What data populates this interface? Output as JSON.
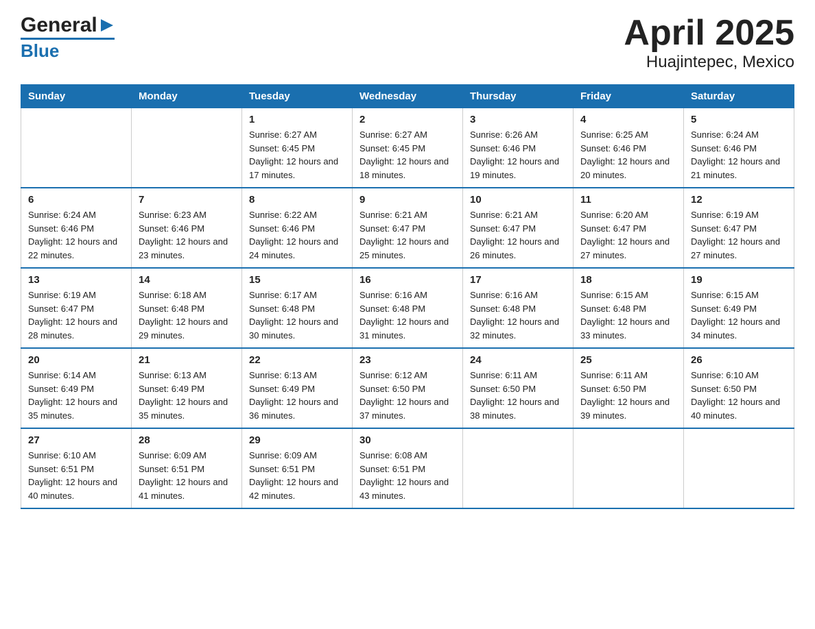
{
  "header": {
    "logo": {
      "general": "General",
      "arrow": "▶",
      "blue": "Blue"
    },
    "title": "April 2025",
    "subtitle": "Huajintepec, Mexico"
  },
  "days_of_week": [
    "Sunday",
    "Monday",
    "Tuesday",
    "Wednesday",
    "Thursday",
    "Friday",
    "Saturday"
  ],
  "weeks": [
    [
      {
        "day": "",
        "sunrise": "",
        "sunset": "",
        "daylight": ""
      },
      {
        "day": "",
        "sunrise": "",
        "sunset": "",
        "daylight": ""
      },
      {
        "day": "1",
        "sunrise": "Sunrise: 6:27 AM",
        "sunset": "Sunset: 6:45 PM",
        "daylight": "Daylight: 12 hours and 17 minutes."
      },
      {
        "day": "2",
        "sunrise": "Sunrise: 6:27 AM",
        "sunset": "Sunset: 6:45 PM",
        "daylight": "Daylight: 12 hours and 18 minutes."
      },
      {
        "day": "3",
        "sunrise": "Sunrise: 6:26 AM",
        "sunset": "Sunset: 6:46 PM",
        "daylight": "Daylight: 12 hours and 19 minutes."
      },
      {
        "day": "4",
        "sunrise": "Sunrise: 6:25 AM",
        "sunset": "Sunset: 6:46 PM",
        "daylight": "Daylight: 12 hours and 20 minutes."
      },
      {
        "day": "5",
        "sunrise": "Sunrise: 6:24 AM",
        "sunset": "Sunset: 6:46 PM",
        "daylight": "Daylight: 12 hours and 21 minutes."
      }
    ],
    [
      {
        "day": "6",
        "sunrise": "Sunrise: 6:24 AM",
        "sunset": "Sunset: 6:46 PM",
        "daylight": "Daylight: 12 hours and 22 minutes."
      },
      {
        "day": "7",
        "sunrise": "Sunrise: 6:23 AM",
        "sunset": "Sunset: 6:46 PM",
        "daylight": "Daylight: 12 hours and 23 minutes."
      },
      {
        "day": "8",
        "sunrise": "Sunrise: 6:22 AM",
        "sunset": "Sunset: 6:46 PM",
        "daylight": "Daylight: 12 hours and 24 minutes."
      },
      {
        "day": "9",
        "sunrise": "Sunrise: 6:21 AM",
        "sunset": "Sunset: 6:47 PM",
        "daylight": "Daylight: 12 hours and 25 minutes."
      },
      {
        "day": "10",
        "sunrise": "Sunrise: 6:21 AM",
        "sunset": "Sunset: 6:47 PM",
        "daylight": "Daylight: 12 hours and 26 minutes."
      },
      {
        "day": "11",
        "sunrise": "Sunrise: 6:20 AM",
        "sunset": "Sunset: 6:47 PM",
        "daylight": "Daylight: 12 hours and 27 minutes."
      },
      {
        "day": "12",
        "sunrise": "Sunrise: 6:19 AM",
        "sunset": "Sunset: 6:47 PM",
        "daylight": "Daylight: 12 hours and 27 minutes."
      }
    ],
    [
      {
        "day": "13",
        "sunrise": "Sunrise: 6:19 AM",
        "sunset": "Sunset: 6:47 PM",
        "daylight": "Daylight: 12 hours and 28 minutes."
      },
      {
        "day": "14",
        "sunrise": "Sunrise: 6:18 AM",
        "sunset": "Sunset: 6:48 PM",
        "daylight": "Daylight: 12 hours and 29 minutes."
      },
      {
        "day": "15",
        "sunrise": "Sunrise: 6:17 AM",
        "sunset": "Sunset: 6:48 PM",
        "daylight": "Daylight: 12 hours and 30 minutes."
      },
      {
        "day": "16",
        "sunrise": "Sunrise: 6:16 AM",
        "sunset": "Sunset: 6:48 PM",
        "daylight": "Daylight: 12 hours and 31 minutes."
      },
      {
        "day": "17",
        "sunrise": "Sunrise: 6:16 AM",
        "sunset": "Sunset: 6:48 PM",
        "daylight": "Daylight: 12 hours and 32 minutes."
      },
      {
        "day": "18",
        "sunrise": "Sunrise: 6:15 AM",
        "sunset": "Sunset: 6:48 PM",
        "daylight": "Daylight: 12 hours and 33 minutes."
      },
      {
        "day": "19",
        "sunrise": "Sunrise: 6:15 AM",
        "sunset": "Sunset: 6:49 PM",
        "daylight": "Daylight: 12 hours and 34 minutes."
      }
    ],
    [
      {
        "day": "20",
        "sunrise": "Sunrise: 6:14 AM",
        "sunset": "Sunset: 6:49 PM",
        "daylight": "Daylight: 12 hours and 35 minutes."
      },
      {
        "day": "21",
        "sunrise": "Sunrise: 6:13 AM",
        "sunset": "Sunset: 6:49 PM",
        "daylight": "Daylight: 12 hours and 35 minutes."
      },
      {
        "day": "22",
        "sunrise": "Sunrise: 6:13 AM",
        "sunset": "Sunset: 6:49 PM",
        "daylight": "Daylight: 12 hours and 36 minutes."
      },
      {
        "day": "23",
        "sunrise": "Sunrise: 6:12 AM",
        "sunset": "Sunset: 6:50 PM",
        "daylight": "Daylight: 12 hours and 37 minutes."
      },
      {
        "day": "24",
        "sunrise": "Sunrise: 6:11 AM",
        "sunset": "Sunset: 6:50 PM",
        "daylight": "Daylight: 12 hours and 38 minutes."
      },
      {
        "day": "25",
        "sunrise": "Sunrise: 6:11 AM",
        "sunset": "Sunset: 6:50 PM",
        "daylight": "Daylight: 12 hours and 39 minutes."
      },
      {
        "day": "26",
        "sunrise": "Sunrise: 6:10 AM",
        "sunset": "Sunset: 6:50 PM",
        "daylight": "Daylight: 12 hours and 40 minutes."
      }
    ],
    [
      {
        "day": "27",
        "sunrise": "Sunrise: 6:10 AM",
        "sunset": "Sunset: 6:51 PM",
        "daylight": "Daylight: 12 hours and 40 minutes."
      },
      {
        "day": "28",
        "sunrise": "Sunrise: 6:09 AM",
        "sunset": "Sunset: 6:51 PM",
        "daylight": "Daylight: 12 hours and 41 minutes."
      },
      {
        "day": "29",
        "sunrise": "Sunrise: 6:09 AM",
        "sunset": "Sunset: 6:51 PM",
        "daylight": "Daylight: 12 hours and 42 minutes."
      },
      {
        "day": "30",
        "sunrise": "Sunrise: 6:08 AM",
        "sunset": "Sunset: 6:51 PM",
        "daylight": "Daylight: 12 hours and 43 minutes."
      },
      {
        "day": "",
        "sunrise": "",
        "sunset": "",
        "daylight": ""
      },
      {
        "day": "",
        "sunrise": "",
        "sunset": "",
        "daylight": ""
      },
      {
        "day": "",
        "sunrise": "",
        "sunset": "",
        "daylight": ""
      }
    ]
  ]
}
